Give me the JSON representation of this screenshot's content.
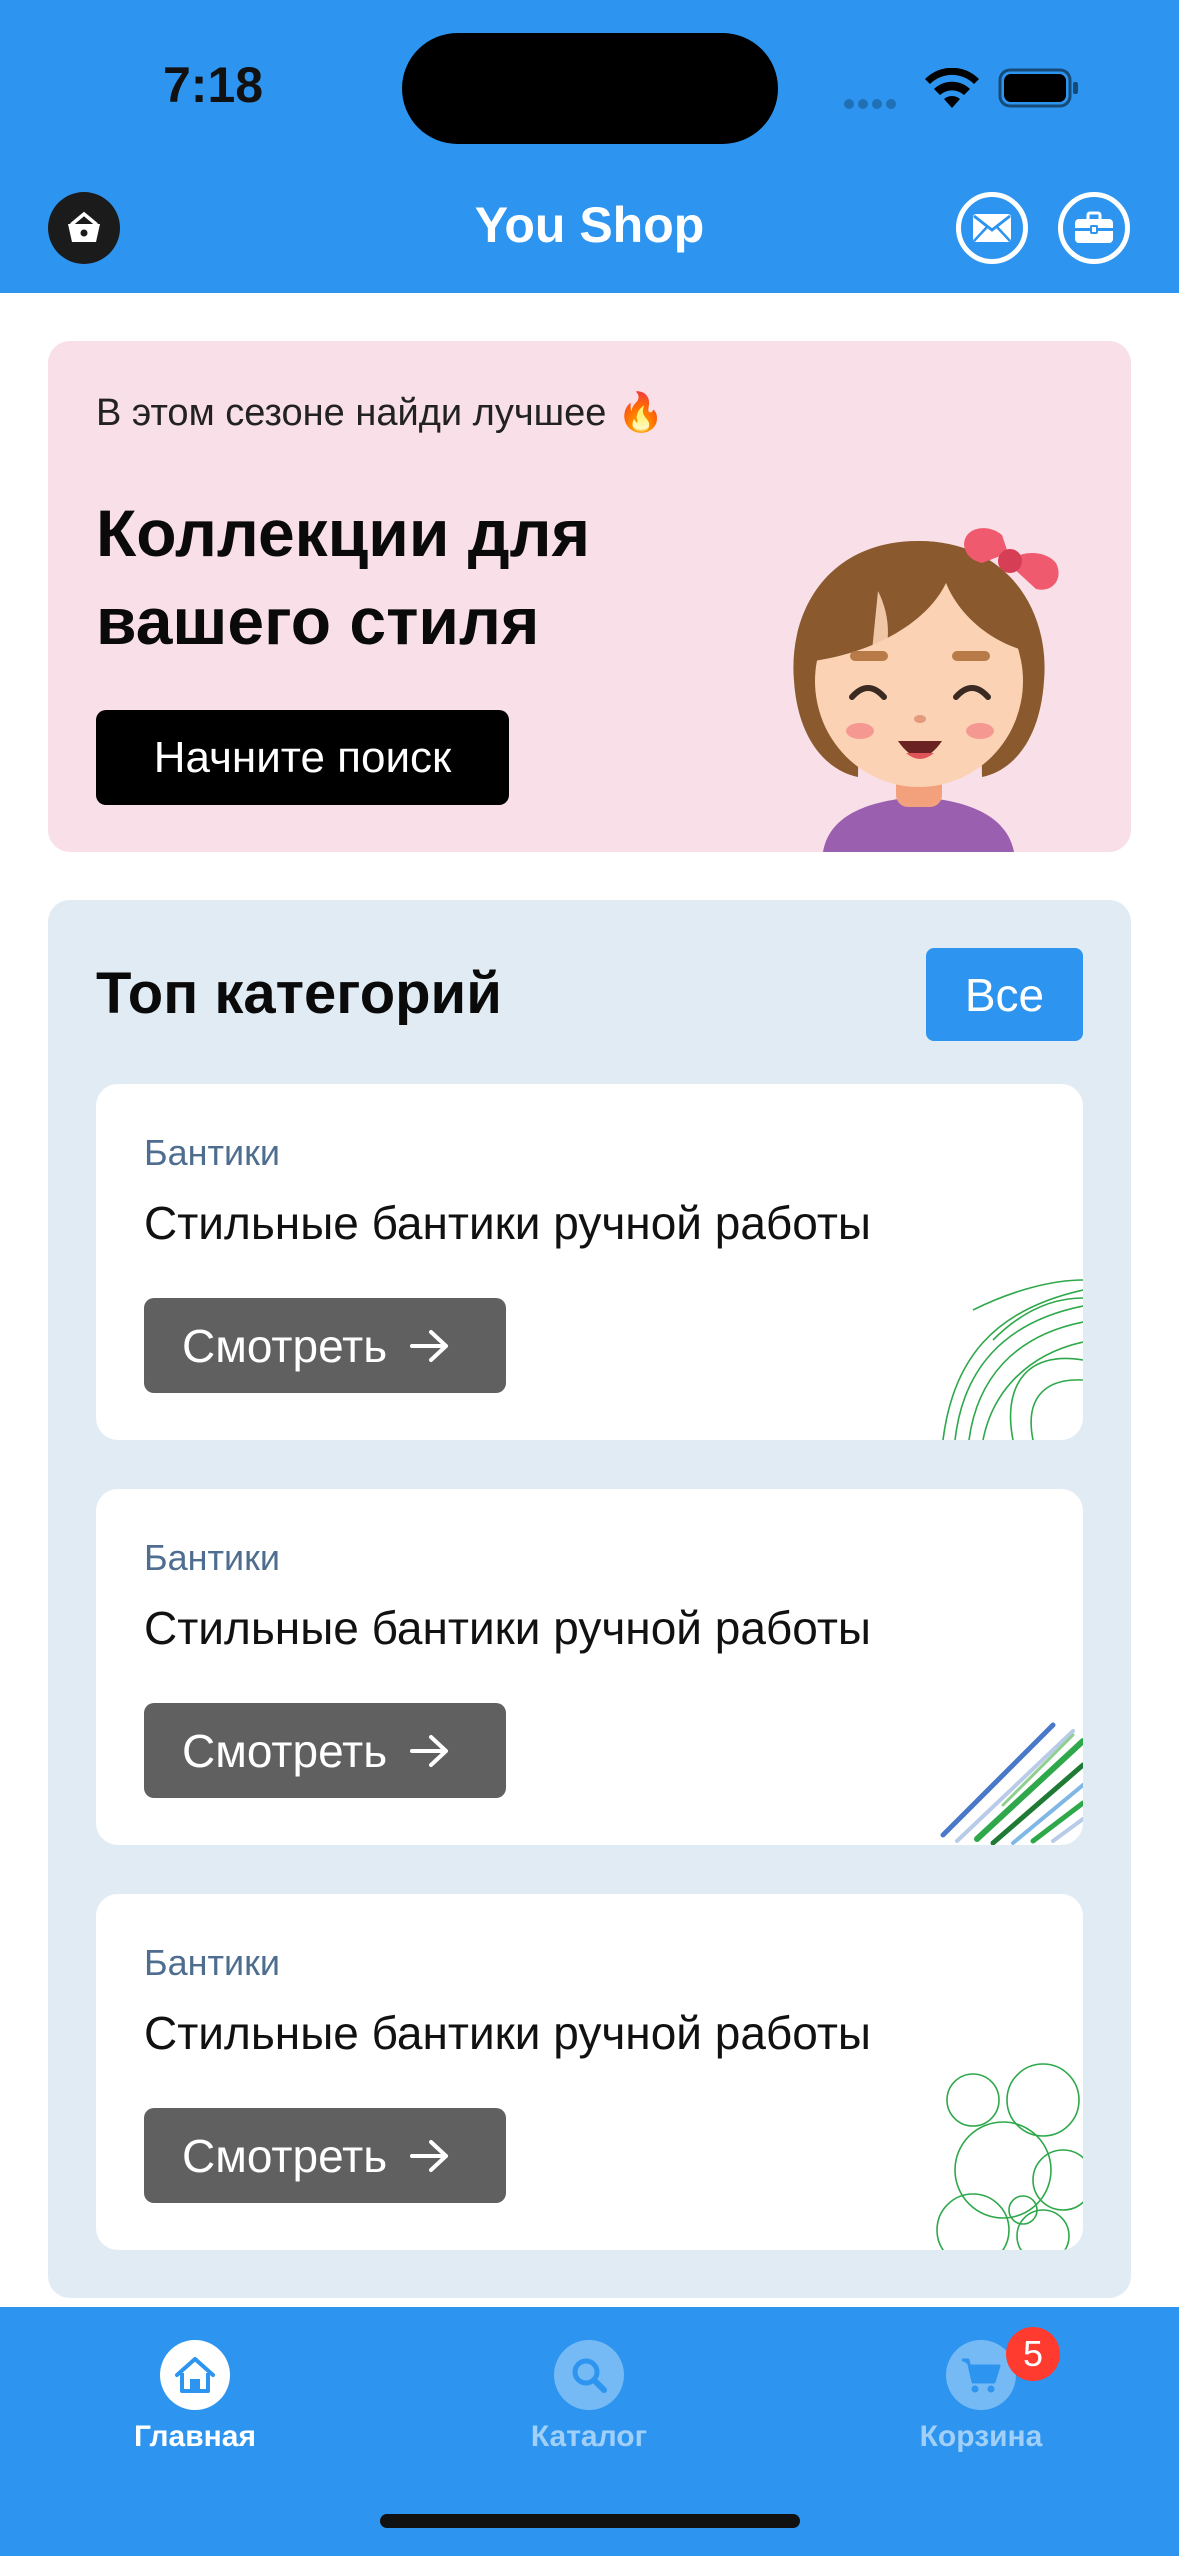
{
  "status_bar": {
    "time": "7:18"
  },
  "header": {
    "title": "You Shop",
    "basket_icon": "basket-icon",
    "mail_icon": "mail-icon",
    "briefcase_icon": "briefcase-icon",
    "color": "#2d95f0"
  },
  "promo": {
    "eyebrow": "В этом сезоне найди лучшее 🔥",
    "title": "Коллекции для вашего стиля",
    "button_label": "Начните поиск",
    "background": "#f9dfe8"
  },
  "categories": {
    "title": "Топ категорий",
    "all_label": "Все",
    "items": [
      {
        "tag": "Бантики",
        "description": "Стильные бантики ручной работы",
        "button_label": "Смотреть"
      },
      {
        "tag": "Бантики",
        "description": "Стильные бантики ручной работы",
        "button_label": "Смотреть"
      },
      {
        "tag": "Бантики",
        "description": "Стильные бантики ручной работы",
        "button_label": "Смотреть"
      }
    ]
  },
  "tabbar": {
    "tabs": [
      {
        "label": "Главная",
        "icon": "home-icon",
        "active": true
      },
      {
        "label": "Каталог",
        "icon": "search-icon",
        "active": false
      },
      {
        "label": "Корзина",
        "icon": "cart-icon",
        "active": false,
        "badge": "5"
      }
    ]
  }
}
